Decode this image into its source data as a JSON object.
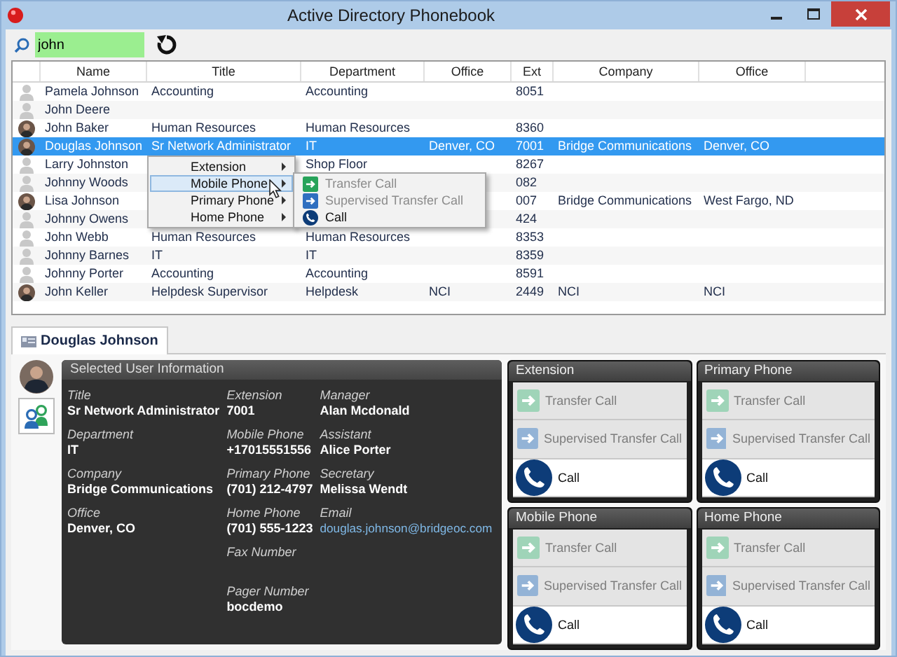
{
  "window": {
    "title": "Active Directory Phonebook"
  },
  "search": {
    "value": "john"
  },
  "table": {
    "columns": [
      "Name",
      "Title",
      "Department",
      "Office",
      "Ext",
      "Company",
      "Office"
    ],
    "rows": [
      {
        "kind": "generic",
        "selected": false,
        "cells": [
          "Pamela Johnson",
          "Accounting",
          "Accounting",
          null,
          "8051",
          null,
          null
        ]
      },
      {
        "kind": "generic",
        "selected": false,
        "cells": [
          "John Deere",
          null,
          null,
          null,
          null,
          null,
          null
        ]
      },
      {
        "kind": "photo",
        "selected": false,
        "cells": [
          "John Baker",
          "Human Resources",
          "Human Resources",
          null,
          "8360",
          null,
          null
        ]
      },
      {
        "kind": "photo",
        "selected": true,
        "cells": [
          "Douglas Johnson",
          "Sr Network Administrator",
          "IT",
          "Denver, CO",
          "7001",
          "Bridge Communications",
          "Denver, CO"
        ]
      },
      {
        "kind": "generic",
        "selected": false,
        "cells": [
          "Larry Johnston",
          null,
          "Shop Floor",
          null,
          "8267",
          null,
          null
        ]
      },
      {
        "kind": "generic",
        "selected": false,
        "cells": [
          "Johnny Woods",
          null,
          null,
          null,
          "082",
          null,
          null
        ]
      },
      {
        "kind": "photo",
        "selected": false,
        "cells": [
          "Lisa Johnson",
          null,
          null,
          null,
          "007",
          "Bridge Communications",
          "West Fargo, ND"
        ]
      },
      {
        "kind": "generic",
        "selected": false,
        "cells": [
          "Johnny Owens",
          null,
          null,
          null,
          "424",
          null,
          null
        ]
      },
      {
        "kind": "generic",
        "selected": false,
        "cells": [
          "John Webb",
          "Human Resources",
          "Human Resources",
          null,
          "8353",
          null,
          null
        ]
      },
      {
        "kind": "generic",
        "selected": false,
        "cells": [
          "Johnny Barnes",
          "IT",
          "IT",
          null,
          "8359",
          null,
          null
        ]
      },
      {
        "kind": "generic",
        "selected": false,
        "cells": [
          "Johnny Porter",
          "Accounting",
          "Accounting",
          null,
          "8591",
          null,
          null
        ]
      },
      {
        "kind": "photo",
        "selected": false,
        "cells": [
          "John Keller",
          "Helpdesk Supervisor",
          "Helpdesk",
          "NCI",
          "2449",
          "NCI",
          "NCI"
        ]
      }
    ]
  },
  "context_menu": {
    "items": [
      {
        "label": "Extension",
        "selected": false
      },
      {
        "label": "Mobile Phone",
        "selected": true
      },
      {
        "label": "Primary Phone",
        "selected": false
      },
      {
        "label": "Home Phone",
        "selected": false
      }
    ],
    "submenu": [
      {
        "kind": "transfer",
        "label": "Transfer Call",
        "disabled": true
      },
      {
        "kind": "supervised",
        "label": "Supervised Transfer Call",
        "disabled": true
      },
      {
        "kind": "call",
        "label": "Call",
        "disabled": false
      }
    ]
  },
  "tabs": [
    {
      "label": "Douglas Johnson",
      "selected": true
    }
  ],
  "details": {
    "title": "Selected User Information",
    "columns": [
      [
        {
          "label": "Title",
          "value": "Sr Network Administrator",
          "kind": "text"
        },
        {
          "label": "Department",
          "value": "IT",
          "kind": "text"
        },
        {
          "label": "Company",
          "value": "Bridge Communications",
          "kind": "text"
        },
        {
          "label": "Office",
          "value": "Denver, CO",
          "kind": "text"
        }
      ],
      [
        {
          "label": "Extension",
          "value": "7001",
          "kind": "text"
        },
        {
          "label": "Mobile Phone",
          "value": "+17015551556",
          "kind": "text"
        },
        {
          "label": "Primary Phone",
          "value": "(701) 212-4797",
          "kind": "text"
        },
        {
          "label": "Home Phone",
          "value": "(701) 555-1223",
          "kind": "text"
        },
        {
          "label": "Fax Number",
          "kind": "text"
        },
        {
          "label": "Pager Number",
          "value": "bocdemo",
          "kind": "text"
        }
      ],
      [
        {
          "label": "Manager",
          "value": "Alan Mcdonald",
          "kind": "text"
        },
        {
          "label": "Assistant",
          "value": "Alice Porter",
          "kind": "text"
        },
        {
          "label": "Secretary",
          "value": "Melissa Wendt",
          "kind": "text"
        },
        {
          "label": "Email",
          "value": "douglas.johnson@bridgeoc.com",
          "kind": "link"
        }
      ]
    ]
  },
  "cards": [
    {
      "title": "Extension",
      "actions": [
        {
          "kind": "transfer",
          "label": "Transfer Call",
          "disabled": true
        },
        {
          "kind": "supervised",
          "label": "Supervised Transfer Call",
          "disabled": true
        },
        {
          "kind": "call",
          "label": "Call",
          "disabled": false
        }
      ]
    },
    {
      "title": "Primary Phone",
      "actions": [
        {
          "kind": "transfer",
          "label": "Transfer Call",
          "disabled": true
        },
        {
          "kind": "supervised",
          "label": "Supervised Transfer Call",
          "disabled": true
        },
        {
          "kind": "call",
          "label": "Call",
          "disabled": false
        }
      ]
    },
    {
      "title": "Mobile Phone",
      "actions": [
        {
          "kind": "transfer",
          "label": "Transfer Call",
          "disabled": true
        },
        {
          "kind": "supervised",
          "label": "Supervised Transfer Call",
          "disabled": true
        },
        {
          "kind": "call",
          "label": "Call",
          "disabled": false
        }
      ]
    },
    {
      "title": "Home Phone",
      "actions": [
        {
          "kind": "transfer",
          "label": "Transfer Call",
          "disabled": true
        },
        {
          "kind": "supervised",
          "label": "Supervised Transfer Call",
          "disabled": true
        },
        {
          "kind": "call",
          "label": "Call",
          "disabled": false
        }
      ]
    }
  ]
}
